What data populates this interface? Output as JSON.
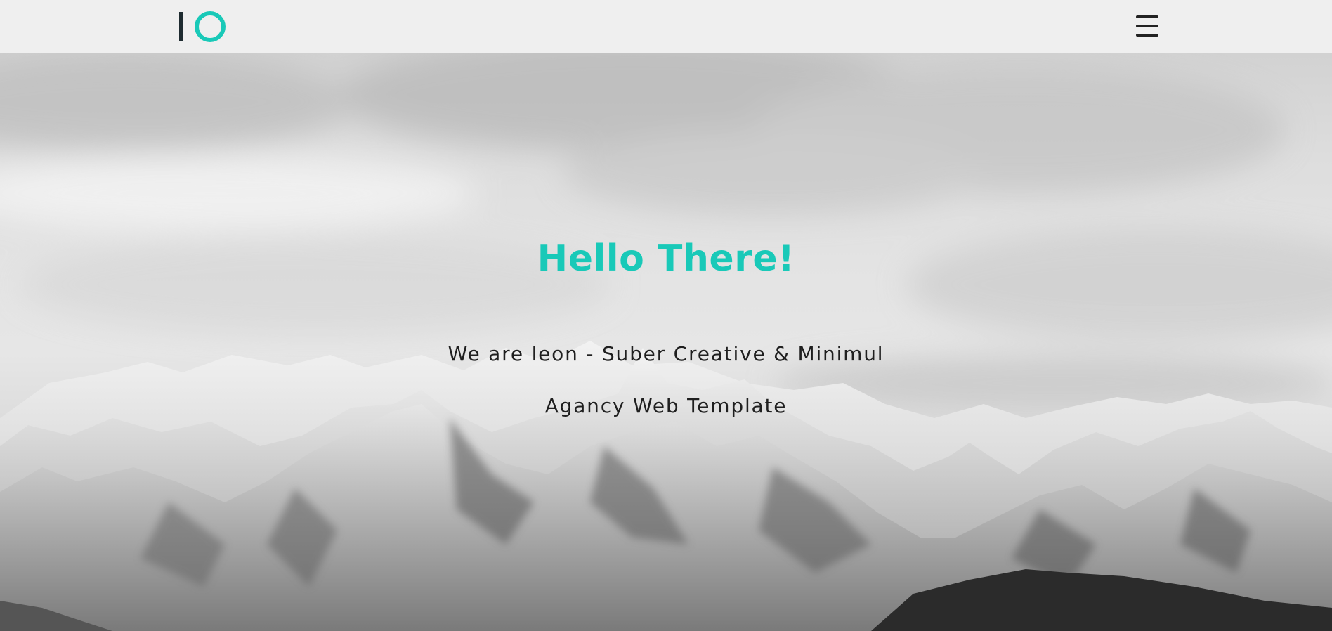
{
  "header": {
    "logo_text": "IO",
    "menu_icon": "hamburger-menu-icon"
  },
  "hero": {
    "title": "Hello There!",
    "subtitle_line1": "We are leon - Suber Creative & Minimul",
    "subtitle_line2": "Agancy Web Template",
    "background_image": "snowy-mountains-grayscale"
  },
  "colors": {
    "accent": "#19c9b8",
    "logo_bar": "#1e2b30",
    "text_dark": "#1f1f1f",
    "navbar_bg": "#efefef"
  }
}
